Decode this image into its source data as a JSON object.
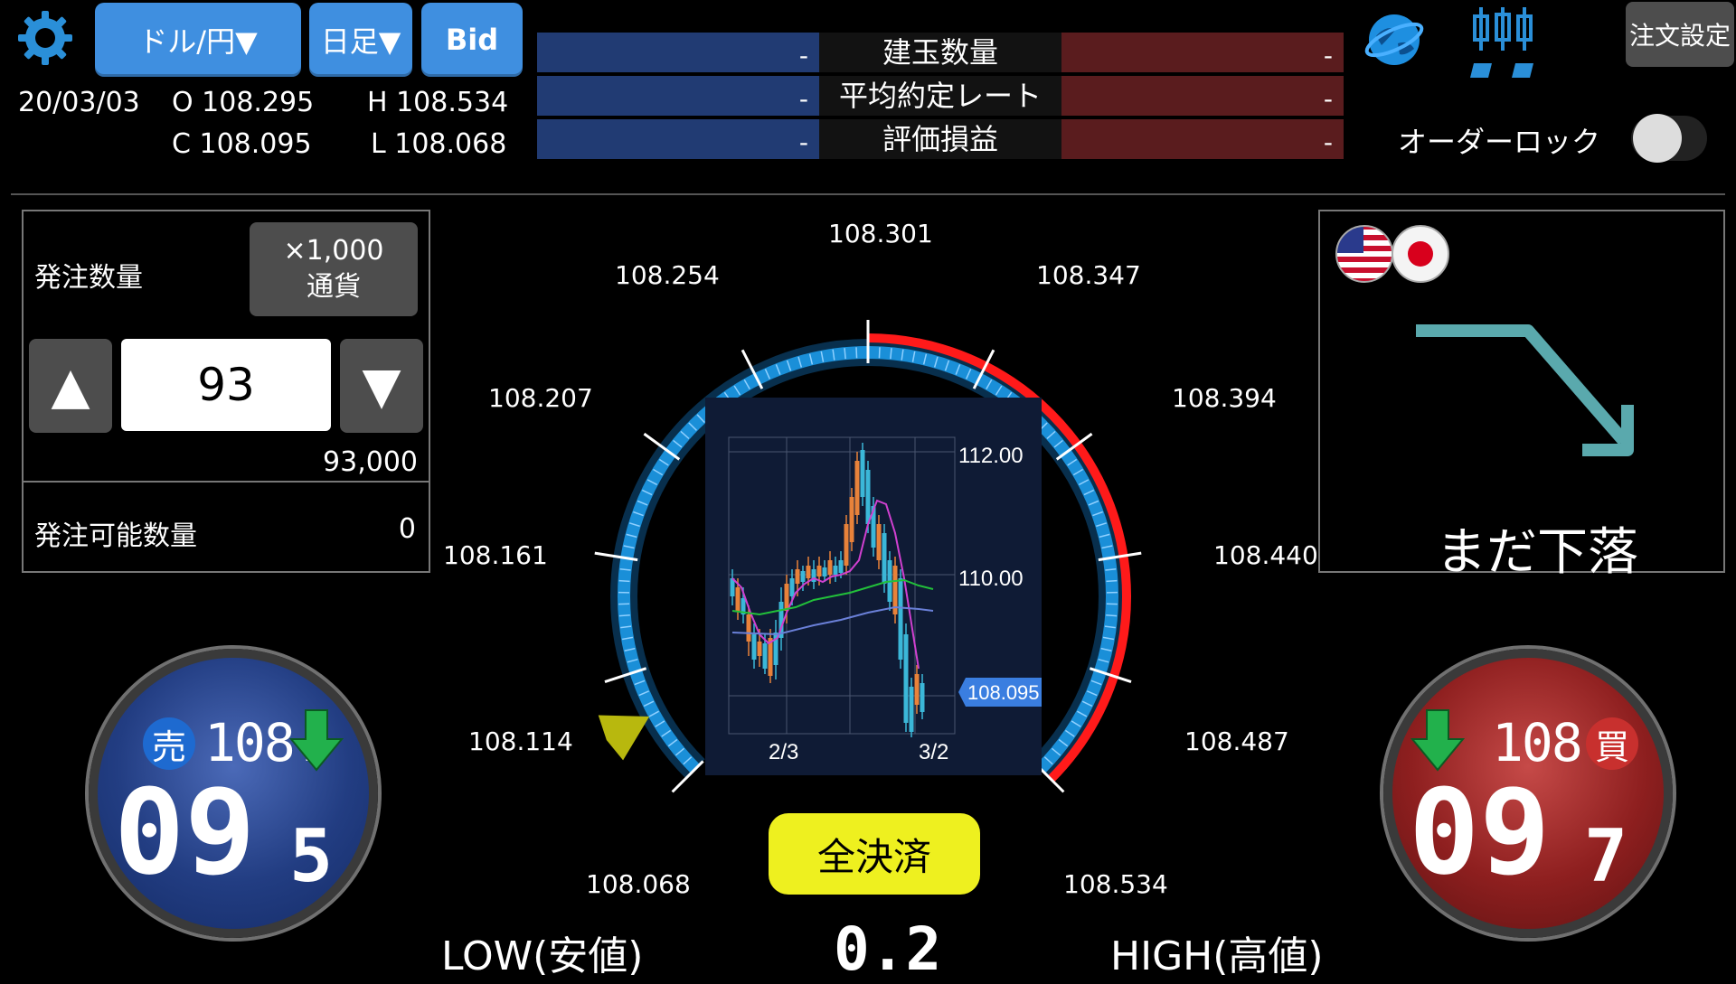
{
  "toolbar": {
    "pair_label": "ドル/円▼",
    "timeframe_label": "日足▼",
    "price_type_label": "Bid",
    "order_settings_label": "注文設定"
  },
  "ohlc": {
    "date": "20/03/03",
    "open": "O 108.295",
    "high": "H 108.534",
    "close": "C 108.095",
    "low": "L 108.068"
  },
  "position_table": {
    "rows": [
      {
        "label": "建玉数量",
        "sell": "-",
        "buy": "-"
      },
      {
        "label": "平均約定レート",
        "sell": "-",
        "buy": "-"
      },
      {
        "label": "評価損益",
        "sell": "-",
        "buy": "-"
      }
    ]
  },
  "order_lock": {
    "label": "オーダーロック",
    "enabled": false
  },
  "order_panel": {
    "quantity_label": "発注数量",
    "unit_line1": "×1,000",
    "unit_line2": "通貨",
    "up_glyph": "▲",
    "down_glyph": "▼",
    "quantity_value": "93",
    "quantity_total": "93,000",
    "available_label": "発注可能数量",
    "available_value": "0"
  },
  "gauge": {
    "ticks": [
      "108.068",
      "108.114",
      "108.161",
      "108.207",
      "108.254",
      "108.301",
      "108.347",
      "108.394",
      "108.440",
      "108.487",
      "108.534"
    ],
    "low_label": "LOW(安値)",
    "high_label": "HIGH(高値)",
    "spread": "0.2",
    "current_price_fraction": 0.06,
    "red_range_fraction": [
      0.5,
      1.0
    ]
  },
  "mini_chart": {
    "y_labels": [
      "112.00",
      "110.00"
    ],
    "x_labels": [
      "2/3",
      "3/2"
    ],
    "current_price": "108.095"
  },
  "close_all_label": "全決済",
  "forecast": {
    "text": "まだ下落"
  },
  "sell_button": {
    "badge": "売",
    "prefix": "108.",
    "big": "09",
    "small": "5"
  },
  "buy_button": {
    "badge": "買",
    "prefix": "108.",
    "big": "09",
    "small": "7"
  },
  "colors": {
    "accent_blue": "#3f8fe0",
    "sell_blue": "#213b73",
    "buy_red": "#5a1c1e",
    "gauge_blue": "#1a8fd8",
    "gauge_red": "#ff1a1a",
    "close_all_yellow": "#eef01f"
  },
  "chart_data": {
    "type": "candlestick",
    "x_labels": [
      "2/3",
      "3/2"
    ],
    "y_labels": [
      "112.00",
      "110.00"
    ],
    "last_price": 108.095
  }
}
